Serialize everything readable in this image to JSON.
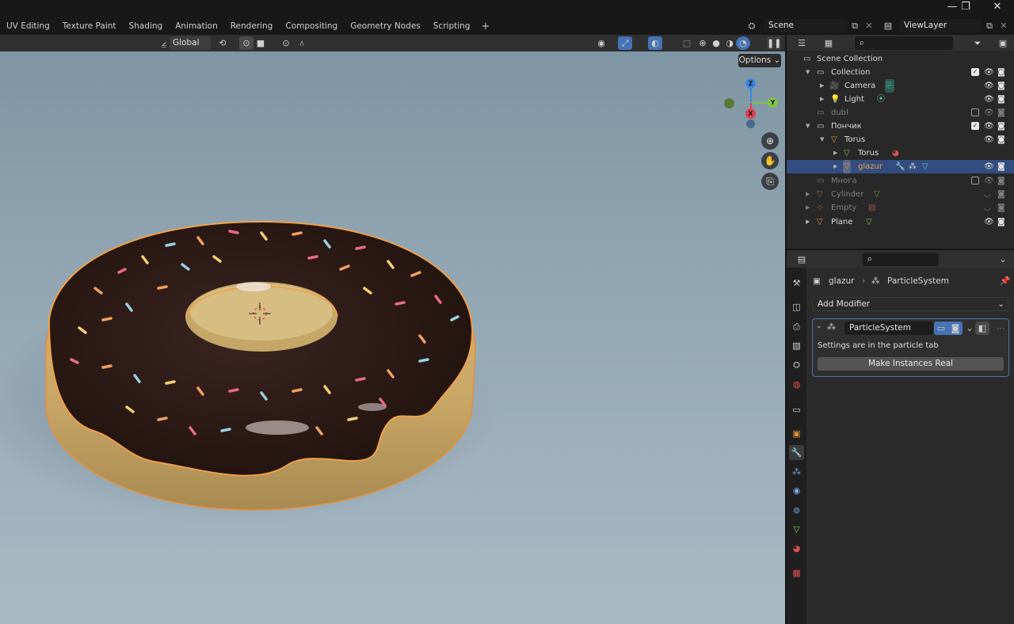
{
  "window": {
    "minimize": "—",
    "maximize": "❐",
    "close": "✕"
  },
  "workspace": {
    "tabs": [
      "UV Editing",
      "Texture Paint",
      "Shading",
      "Animation",
      "Rendering",
      "Compositing",
      "Geometry Nodes",
      "Scripting"
    ],
    "add": "+"
  },
  "scene": {
    "name": "Scene",
    "viewlayer": "ViewLayer"
  },
  "viewport": {
    "orientation": "Global",
    "options_label": "Options",
    "gizmo": {
      "z": "Z",
      "y": "Y",
      "x": "X"
    }
  },
  "outliner": {
    "root": "Scene Collection",
    "rows": [
      {
        "label": "Collection"
      },
      {
        "label": "Camera"
      },
      {
        "label": "Light"
      },
      {
        "label": "dubl"
      },
      {
        "label": "Пончик"
      },
      {
        "label": "Torus"
      },
      {
        "label": "Torus"
      },
      {
        "label": "glazur"
      },
      {
        "label": "Многа"
      },
      {
        "label": "Cylinder"
      },
      {
        "label": "Empty"
      },
      {
        "label": "Plane"
      }
    ]
  },
  "properties": {
    "breadcrumb": {
      "object": "glazur",
      "modifier": "ParticleSystem"
    },
    "add_modifier": "Add Modifier",
    "modifier": {
      "name": "ParticleSystem",
      "info": "Settings are in the particle tab",
      "button": "Make Instances Real"
    }
  },
  "colors": {
    "accent": "#4772b3",
    "selected_row": "#334d80",
    "orange": "#e8903a",
    "green": "#7ec44a"
  }
}
